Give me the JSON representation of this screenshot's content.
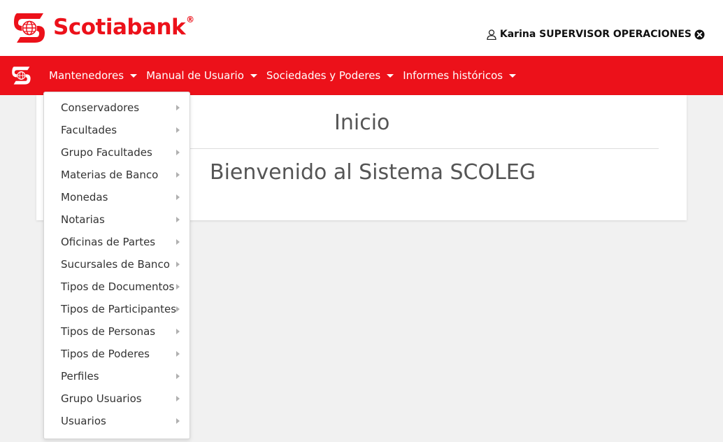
{
  "brand": {
    "name": "Scotiabank",
    "registered_mark": "®",
    "color": "#ec111a"
  },
  "user": {
    "name": "Karina SUPERVISOR OPERACIONES",
    "icon": "user-icon",
    "logout_icon": "close-circle-icon"
  },
  "navbar": {
    "background": "#ec111a",
    "items": [
      {
        "label": "Mantenedores"
      },
      {
        "label": "Manual de Usuario"
      },
      {
        "label": "Sociedades y Poderes"
      },
      {
        "label": "Informes históricos"
      }
    ]
  },
  "main": {
    "title": "Inicio",
    "welcome": "Bienvenido al Sistema SCOLEG"
  },
  "dropdown": {
    "parent": "Mantenedores",
    "items": [
      {
        "label": "Conservadores"
      },
      {
        "label": "Facultades"
      },
      {
        "label": "Grupo Facultades"
      },
      {
        "label": "Materias de Banco"
      },
      {
        "label": "Monedas"
      },
      {
        "label": "Notarias"
      },
      {
        "label": "Oficinas de Partes"
      },
      {
        "label": "Sucursales de Banco"
      },
      {
        "label": "Tipos de Documentos"
      },
      {
        "label": "Tipos de Participantes"
      },
      {
        "label": "Tipos de Personas"
      },
      {
        "label": "Tipos de Poderes"
      },
      {
        "label": "Perfiles"
      },
      {
        "label": "Grupo Usuarios"
      },
      {
        "label": "Usuarios"
      }
    ]
  }
}
